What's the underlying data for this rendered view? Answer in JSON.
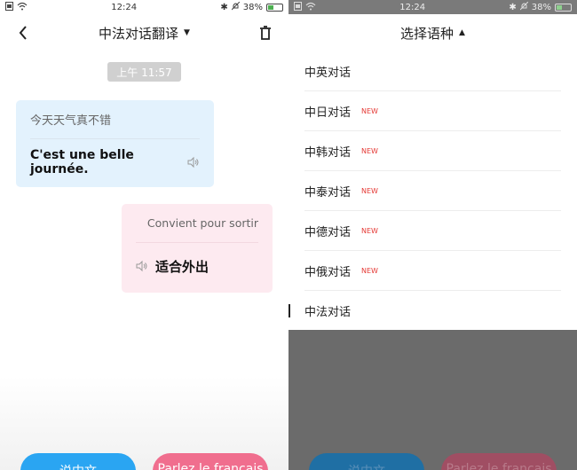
{
  "status": {
    "time": "12:24",
    "battery": "38%",
    "battery_level": 0.38
  },
  "chat_screen": {
    "title": "中法对话翻译",
    "time_chip": "上午 11:57",
    "messages": [
      {
        "source": "今天天气真不错",
        "translation": "C'est une belle journée."
      },
      {
        "source": "Convient pour sortir",
        "translation": "适合外出"
      }
    ],
    "btn_chinese": "说中文",
    "btn_french": "Parlez le français"
  },
  "picker_screen": {
    "title": "选择语种",
    "new_label": "NEW",
    "items": [
      {
        "label": "中英对话",
        "is_new": false
      },
      {
        "label": "中日对话",
        "is_new": true
      },
      {
        "label": "中韩对话",
        "is_new": true
      },
      {
        "label": "中泰对话",
        "is_new": true
      },
      {
        "label": "中德对话",
        "is_new": true
      },
      {
        "label": "中俄对话",
        "is_new": true
      },
      {
        "label": "中法对话",
        "is_new": false,
        "selected": true
      }
    ]
  },
  "colors": {
    "accent_blue": "#2aa5f2",
    "accent_pink": "#f06e8e",
    "bubble_blue": "#e3f2fd",
    "bubble_pink": "#fdeaf0",
    "new_red": "#e53935"
  }
}
